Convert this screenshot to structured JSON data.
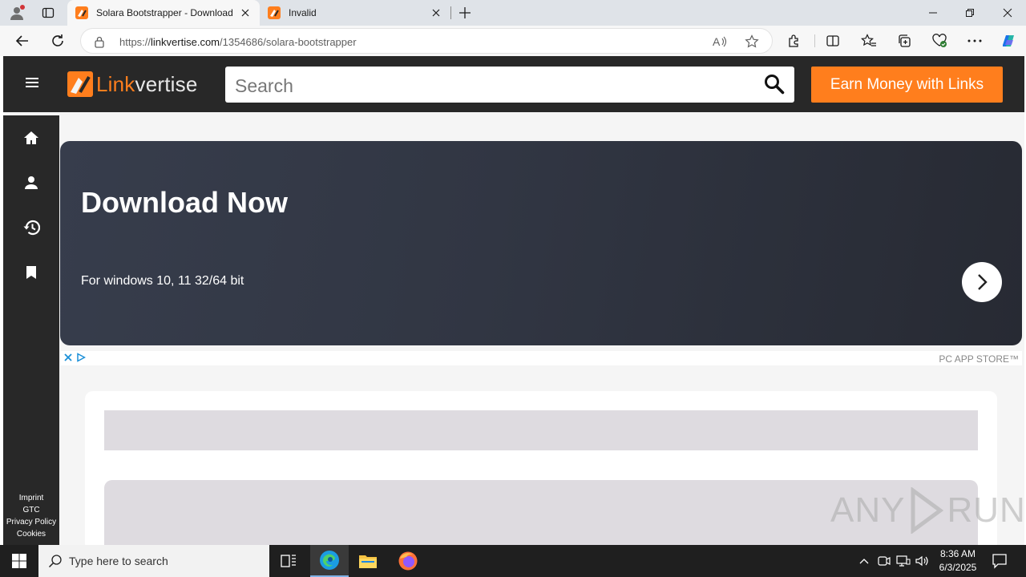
{
  "browser": {
    "tabs": [
      {
        "title": "Solara Bootstrapper - Download"
      },
      {
        "title": "Invalid"
      }
    ],
    "address": {
      "scheme": "https://",
      "host": "linkvertise.com",
      "path": "/1354686/solara-bootstrapper"
    }
  },
  "header": {
    "brand_part1": "Link",
    "brand_part2": "vertise",
    "search_placeholder": "Search",
    "cta_label": "Earn Money with Links",
    "accent_color": "#ff7e1d"
  },
  "sidebar": {
    "icons": [
      "home-icon",
      "user-icon",
      "history-icon",
      "bookmark-icon"
    ],
    "footer_links": [
      "Imprint",
      "GTC",
      "Privacy Policy",
      "Cookies"
    ]
  },
  "banner": {
    "headline": "Download Now",
    "subtitle": "For windows 10, 11 32/64 bit"
  },
  "ad": {
    "label": "PC APP STORE™"
  },
  "watermark": {
    "left": "ANY",
    "right": "RUN"
  },
  "taskbar": {
    "search_placeholder": "Type here to search",
    "time": "8:36 AM",
    "date": "6/3/2025"
  }
}
